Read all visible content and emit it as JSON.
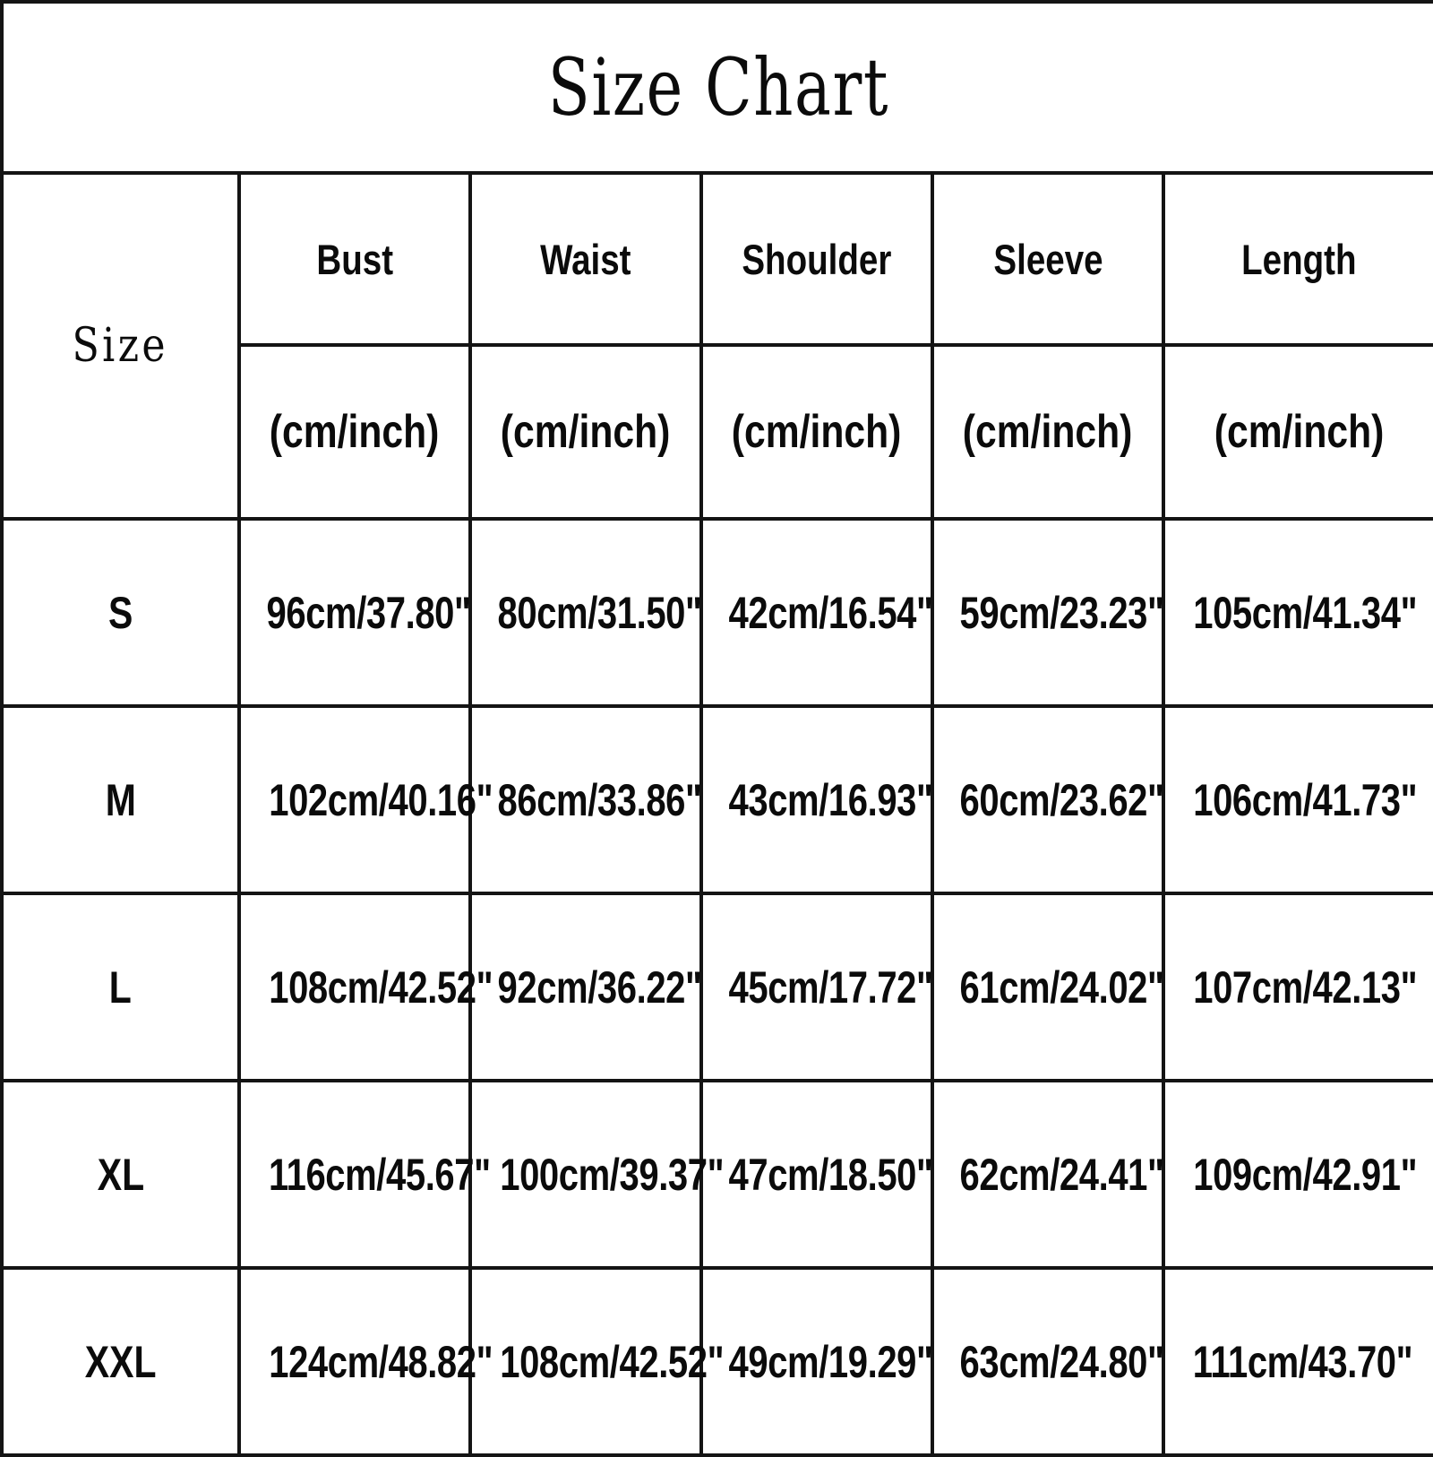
{
  "title": "Size Chart",
  "table": {
    "corner_label": "Size",
    "unit_label": "(cm/inch)",
    "columns": [
      "Bust",
      "Waist",
      "Shoulder",
      "Sleeve",
      "Length"
    ],
    "units": [
      "(cm/inch)",
      "(cm/inch)",
      "(cm/inch)",
      "(cm/inch)",
      "(cm/inch)"
    ],
    "rows": [
      {
        "size": "S",
        "bust": "96cm/37.80\"",
        "waist": "80cm/31.50\"",
        "shoulder": "42cm/16.54\"",
        "sleeve": "59cm/23.23\"",
        "length": "105cm/41.34\""
      },
      {
        "size": "M",
        "bust": "102cm/40.16\"",
        "waist": "86cm/33.86\"",
        "shoulder": "43cm/16.93\"",
        "sleeve": "60cm/23.62\"",
        "length": "106cm/41.73\""
      },
      {
        "size": "L",
        "bust": "108cm/42.52\"",
        "waist": "92cm/36.22\"",
        "shoulder": "45cm/17.72\"",
        "sleeve": "61cm/24.02\"",
        "length": "107cm/42.13\""
      },
      {
        "size": "XL",
        "bust": "116cm/45.67\"",
        "waist": "100cm/39.37\"",
        "shoulder": "47cm/18.50\"",
        "sleeve": "62cm/24.41\"",
        "length": "109cm/42.91\""
      },
      {
        "size": "XXL",
        "bust": "124cm/48.82\"",
        "waist": "108cm/42.52\"",
        "shoulder": "49cm/19.29\"",
        "sleeve": "63cm/24.80\"",
        "length": "111cm/43.70\""
      }
    ]
  },
  "colors": {
    "cell_fill": "#c3c3d9",
    "border": "#141414",
    "background": "#ffffff",
    "text": "#0b0b0b"
  },
  "chart_data": {
    "type": "table",
    "title": "Size Chart",
    "columns": [
      "Size",
      "Bust (cm/inch)",
      "Waist (cm/inch)",
      "Shoulder (cm/inch)",
      "Sleeve (cm/inch)",
      "Length (cm/inch)"
    ],
    "rows": [
      [
        "S",
        "96cm/37.80\"",
        "80cm/31.50\"",
        "42cm/16.54\"",
        "59cm/23.23\"",
        "105cm/41.34\""
      ],
      [
        "M",
        "102cm/40.16\"",
        "86cm/33.86\"",
        "43cm/16.93\"",
        "60cm/23.62\"",
        "106cm/41.73\""
      ],
      [
        "L",
        "108cm/42.52\"",
        "92cm/36.22\"",
        "45cm/17.72\"",
        "61cm/24.02\"",
        "107cm/42.13\""
      ],
      [
        "XL",
        "116cm/45.67\"",
        "100cm/39.37\"",
        "47cm/18.50\"",
        "62cm/24.41\"",
        "109cm/42.91\""
      ],
      [
        "XXL",
        "124cm/48.82\"",
        "108cm/42.52\"",
        "49cm/19.29\"",
        "63cm/24.80\"",
        "111cm/43.70\""
      ]
    ],
    "bust_cm": [
      96,
      102,
      108,
      116,
      124
    ],
    "bust_inch": [
      37.8,
      40.16,
      42.52,
      45.67,
      48.82
    ],
    "waist_cm": [
      80,
      86,
      92,
      100,
      108
    ],
    "waist_inch": [
      31.5,
      33.86,
      36.22,
      39.37,
      42.52
    ],
    "shoulder_cm": [
      42,
      43,
      45,
      47,
      49
    ],
    "shoulder_inch": [
      16.54,
      16.93,
      17.72,
      18.5,
      19.29
    ],
    "sleeve_cm": [
      59,
      60,
      61,
      62,
      63
    ],
    "sleeve_inch": [
      23.23,
      23.62,
      24.02,
      24.41,
      24.8
    ],
    "length_cm": [
      105,
      106,
      107,
      109,
      111
    ],
    "length_inch": [
      41.34,
      41.73,
      42.13,
      42.91,
      43.7
    ],
    "sizes": [
      "S",
      "M",
      "L",
      "XL",
      "XXL"
    ]
  }
}
